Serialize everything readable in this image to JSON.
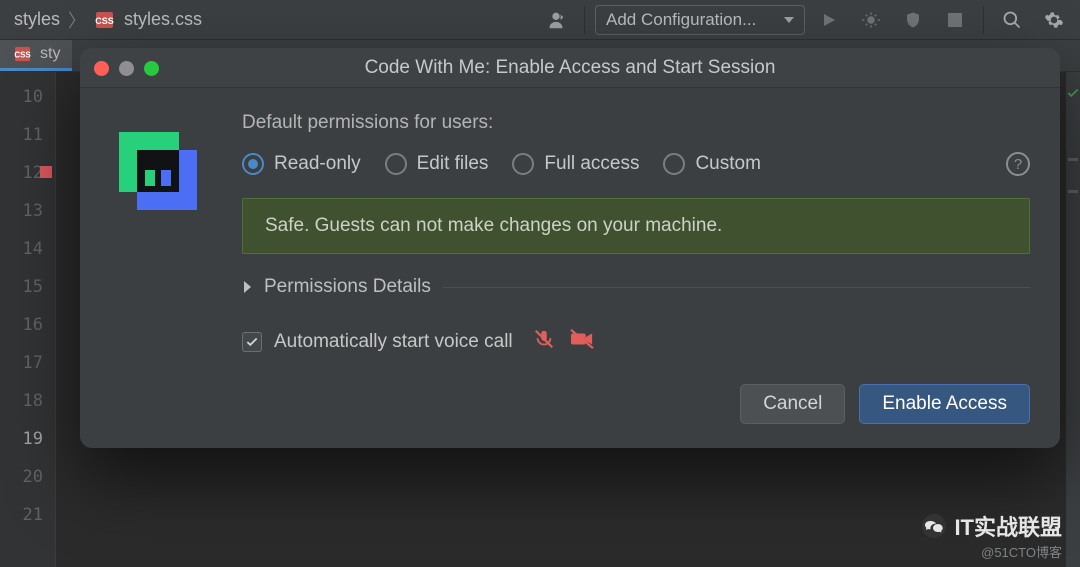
{
  "toolbar": {
    "breadcrumb_root": "styles",
    "breadcrumb_file": "styles.css",
    "config_label": "Add Configuration..."
  },
  "tabs": {
    "active_label": "sty"
  },
  "gutter": {
    "lines": [
      "10",
      "11",
      "12",
      "13",
      "14",
      "15",
      "16",
      "17",
      "18",
      "19",
      "20",
      "21"
    ],
    "current_line_index": 9,
    "bookmark_line_index": 2
  },
  "dialog": {
    "title": "Code With Me: Enable Access and Start Session",
    "section_label": "Default permissions for users:",
    "radios": {
      "read_only": "Read-only",
      "edit_files": "Edit files",
      "full_access": "Full access",
      "custom": "Custom",
      "selected": "read_only"
    },
    "safe_message": "Safe. Guests can not make changes on your machine.",
    "details_label": "Permissions Details",
    "voice_label": "Automatically start voice call",
    "voice_checked": true,
    "buttons": {
      "cancel": "Cancel",
      "enable": "Enable Access"
    }
  },
  "watermark": {
    "brand": "IT实战联盟",
    "sub": "@51CTO博客"
  }
}
